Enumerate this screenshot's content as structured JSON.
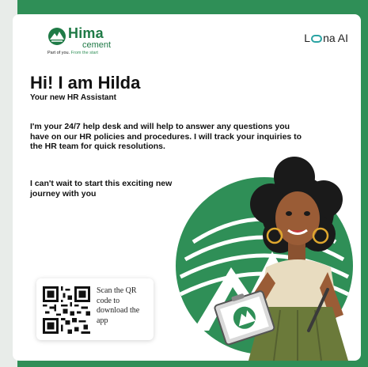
{
  "brand": {
    "name": "Hima",
    "sub": "cement",
    "tagline_part1": "Part of you.",
    "tagline_part2": "From the start"
  },
  "partner": {
    "prefix": "L",
    "middle": "na",
    "suffix": " AI"
  },
  "heading": {
    "title": "Hi! I am Hilda",
    "subtitle": "Your new HR Assistant"
  },
  "body": {
    "paragraph1": "I'm your 24/7 help desk and will help to answer any questions you have on our HR policies and procedures. I will track your inquiries to the HR team for quick resolutions.",
    "paragraph2": "I can't wait to start this exciting new journey with you"
  },
  "qr": {
    "text": "Scan the QR code to download the app"
  },
  "colors": {
    "brand_green": "#1f7a46",
    "frame_green": "#2f8f57",
    "partner_accent": "#2aa3a3"
  }
}
